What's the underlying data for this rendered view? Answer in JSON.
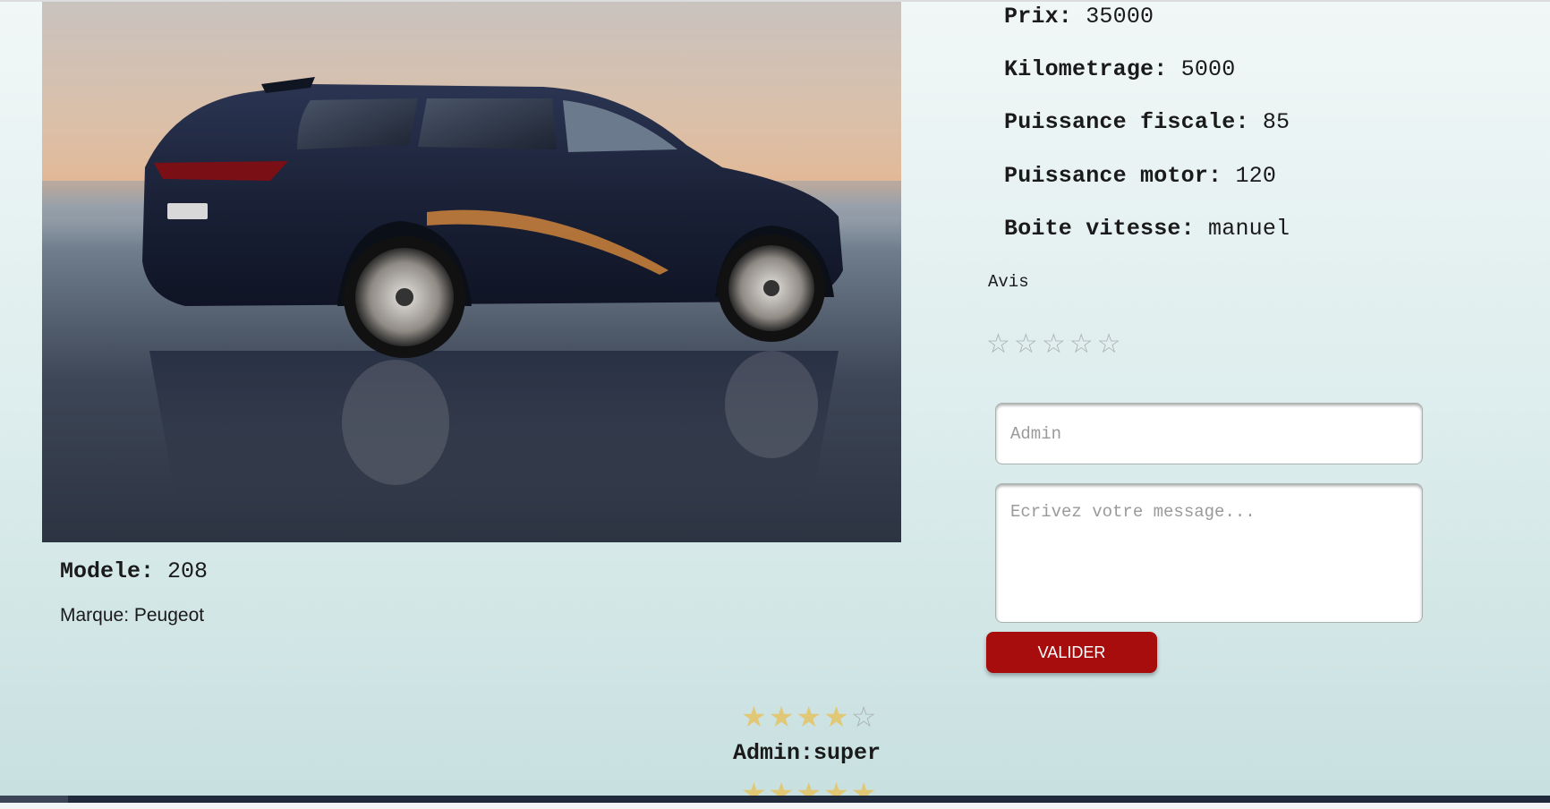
{
  "car": {
    "image_alt": "car-photo",
    "modele_label": "Modele:",
    "modele_value": "208",
    "marque_text": "Marque: Peugeot"
  },
  "specs": [
    {
      "label": "Prix:",
      "value": "35000"
    },
    {
      "label": "Kilometrage:",
      "value": "5000"
    },
    {
      "label": "Puissance fiscale:",
      "value": "85"
    },
    {
      "label": "Puissance motor:",
      "value": "120"
    },
    {
      "label": "Boite vitesse:",
      "value": "manuel"
    }
  ],
  "review_form": {
    "title": "Avis",
    "rating": 0,
    "rating_max": 5,
    "star_empty": "☆",
    "star_filled": "★",
    "name_placeholder": "Admin",
    "message_placeholder": "Ecrivez votre message...",
    "submit_label": "VALIDER",
    "submit_color": "#a70d0d"
  },
  "reviews": [
    {
      "rating": 4,
      "rating_max": 5,
      "text": "Admin:super"
    },
    {
      "rating": 5,
      "rating_max": 5,
      "text": ""
    }
  ],
  "colors": {
    "star_gold": "#e1c877",
    "star_empty": "#a9b1b3"
  }
}
